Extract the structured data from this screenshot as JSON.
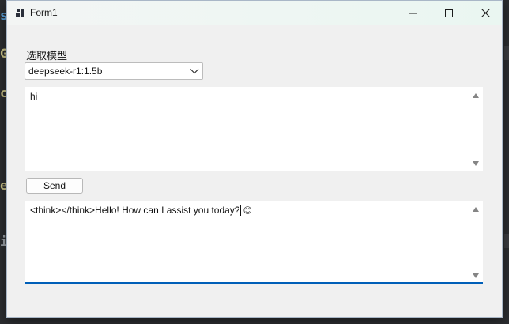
{
  "window": {
    "title": "Form1",
    "controls": {
      "minimize": "minimize-icon",
      "maximize": "maximize-icon",
      "close": "close-icon"
    }
  },
  "model_select": {
    "label": "选取模型",
    "selected": "deepseek-r1:1.5b"
  },
  "input": {
    "value": "hi"
  },
  "send_button": {
    "label": "Send"
  },
  "output": {
    "value": "<think></think>Hello! How can I assist you today?",
    "emoji": "😊"
  },
  "colors": {
    "window_bg": "#f0f0f0",
    "focus_accent": "#005fb8",
    "desktop_bg": "#2b2d30"
  }
}
